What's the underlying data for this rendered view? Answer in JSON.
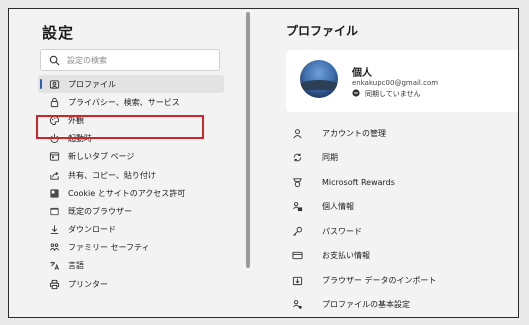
{
  "settings": {
    "title": "設定",
    "search": {
      "placeholder": "設定の検索",
      "icon": "search-icon"
    }
  },
  "sidebar": {
    "items": [
      {
        "label": "プロファイル",
        "icon": "profile-icon",
        "active": true
      },
      {
        "label": "プライバシー、検索、サービス",
        "icon": "lock-icon"
      },
      {
        "label": "外観",
        "icon": "appearance-icon",
        "highlighted": true
      },
      {
        "label": "起動時",
        "icon": "power-icon"
      },
      {
        "label": "新しいタブ ページ",
        "icon": "new-tab-icon"
      },
      {
        "label": "共有、コピー、貼り付け",
        "icon": "share-icon"
      },
      {
        "label": "Cookie とサイトのアクセス許可",
        "icon": "cookie-icon"
      },
      {
        "label": "既定のブラウザー",
        "icon": "browser-icon"
      },
      {
        "label": "ダウンロード",
        "icon": "download-icon"
      },
      {
        "label": "ファミリー セーフティ",
        "icon": "family-icon"
      },
      {
        "label": "言語",
        "icon": "language-icon"
      },
      {
        "label": "プリンター",
        "icon": "printer-icon"
      }
    ]
  },
  "profile": {
    "heading": "プロファイル",
    "name": "個人",
    "email": "enkakupc00@gmail.com",
    "sync_status": "同期していません",
    "menu": [
      {
        "label": "アカウントの管理",
        "icon": "account-icon"
      },
      {
        "label": "同期",
        "icon": "sync-icon"
      },
      {
        "label": "Microsoft Rewards",
        "icon": "rewards-icon"
      },
      {
        "label": "個人情報",
        "icon": "personal-info-icon"
      },
      {
        "label": "パスワード",
        "icon": "key-icon"
      },
      {
        "label": "お支払い情報",
        "icon": "card-icon"
      },
      {
        "label": "ブラウザー データのインポート",
        "icon": "import-icon"
      },
      {
        "label": "プロファイルの基本設定",
        "icon": "profile-settings-icon"
      }
    ]
  },
  "colors": {
    "highlight": "#d0262a",
    "active_indicator": "#2b5fb3",
    "pane_background": "#f3f3f3"
  }
}
